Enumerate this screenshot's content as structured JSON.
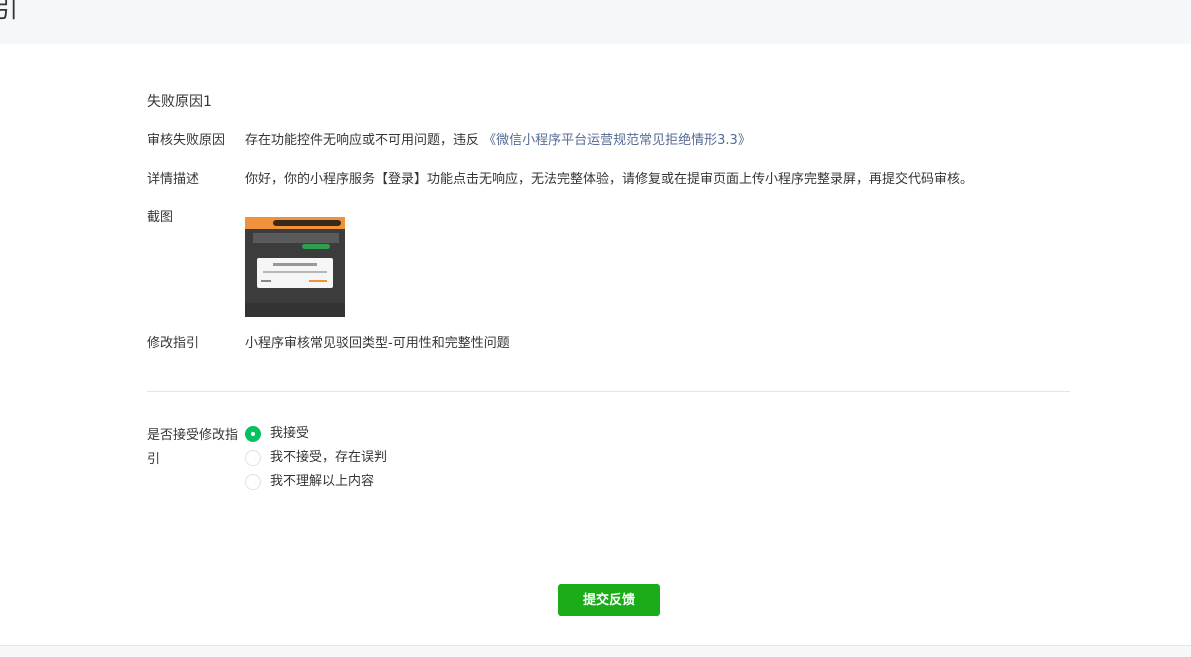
{
  "header": {
    "title": "引"
  },
  "failure": {
    "section_title": "失败原因1",
    "reason_label": "审核失败原因",
    "reason_text": "存在功能控件无响应或不可用问题，违反",
    "reason_link": "《微信小程序平台运营规范常见拒绝情形3.3》",
    "detail_label": "详情描述",
    "detail_text": "你好，你的小程序服务【登录】功能点击无响应，无法完整体验，请修复或在提审页面上传小程序完整录屏，再提交代码审核。",
    "screenshot_label": "截图",
    "guide_label": "修改指引",
    "guide_link": "小程序审核常见驳回类型-可用性和完整性问题"
  },
  "accept": {
    "label": "是否接受修改指引",
    "options": [
      {
        "label": "我接受",
        "checked": true
      },
      {
        "label": "我不接受，存在误判",
        "checked": false
      },
      {
        "label": "我不理解以上内容",
        "checked": false
      }
    ]
  },
  "submit_label": "提交反馈",
  "colors": {
    "link": "#576b95",
    "primary": "#1aad19",
    "radio_checked": "#07c160"
  }
}
